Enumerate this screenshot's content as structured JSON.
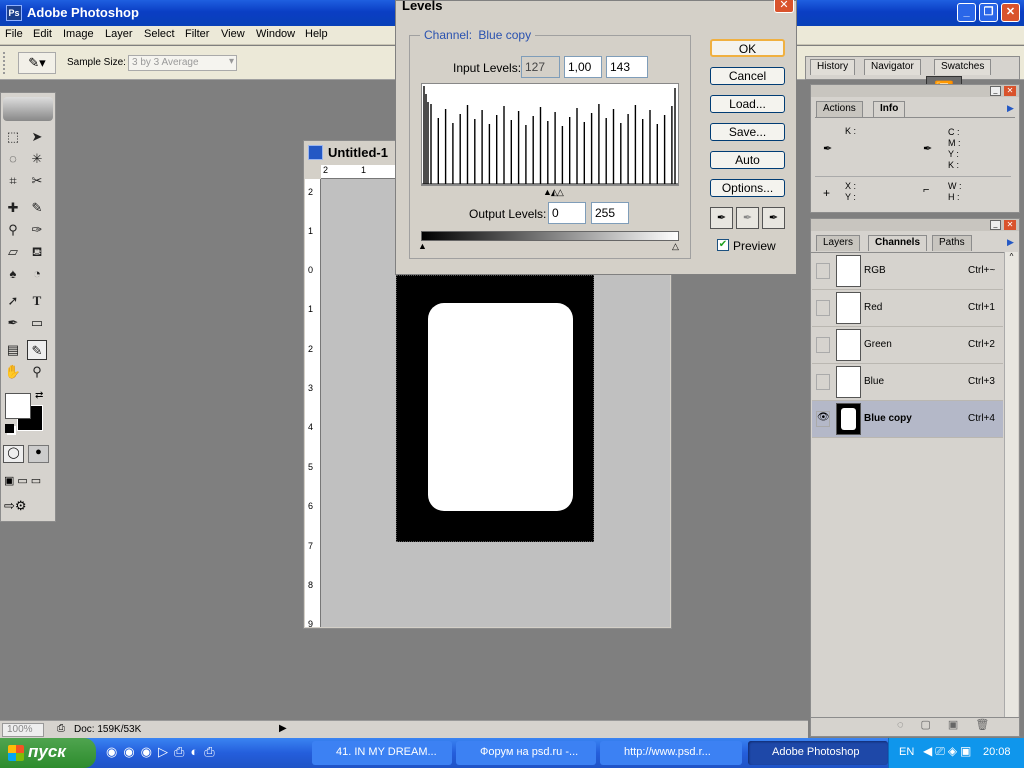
{
  "app": {
    "title": "Adobe Photoshop"
  },
  "menu": [
    "File",
    "Edit",
    "Image",
    "Layer",
    "Select",
    "Filter",
    "View",
    "Window",
    "Help"
  ],
  "options_bar": {
    "sample_size_label": "Sample Size:",
    "sample_size_value": "3 by 3 Average"
  },
  "document": {
    "title": "Untitled-1",
    "ruler_top": [
      "2",
      "1"
    ],
    "ruler_left": [
      "2",
      "1",
      "0",
      "1",
      "2",
      "3",
      "4",
      "5",
      "6",
      "7",
      "8",
      "9"
    ]
  },
  "levels": {
    "title": "Levels",
    "channel_label": "Channel:",
    "channel_value": "Blue copy",
    "input_label": "Input Levels:",
    "input_black": "127",
    "input_gamma": "1,00",
    "input_white": "143",
    "output_label": "Output Levels:",
    "output_black": "0",
    "output_white": "255",
    "buttons": {
      "ok": "OK",
      "cancel": "Cancel",
      "load": "Load...",
      "save": "Save...",
      "auto": "Auto",
      "options": "Options..."
    },
    "preview_label": "Preview",
    "preview_checked": true
  },
  "panel_top": {
    "tabs": [
      "History",
      "Navigator",
      "Swatches"
    ]
  },
  "panel_info": {
    "tabs": [
      "Actions",
      "Info"
    ],
    "k_label": "K :",
    "cmyk_labels": [
      "C :",
      "M :",
      "Y :",
      "K :"
    ],
    "xy_labels": [
      "X :",
      "Y :"
    ],
    "wh_labels": [
      "W :",
      "H :"
    ]
  },
  "panel_channels": {
    "tabs": [
      "Layers",
      "Channels",
      "Paths"
    ],
    "channels": [
      {
        "name": "RGB",
        "shortcut": "Ctrl+~"
      },
      {
        "name": "Red",
        "shortcut": "Ctrl+1"
      },
      {
        "name": "Green",
        "shortcut": "Ctrl+2"
      },
      {
        "name": "Blue",
        "shortcut": "Ctrl+3"
      },
      {
        "name": "Blue copy",
        "shortcut": "Ctrl+4"
      }
    ]
  },
  "status": {
    "zoom": "100%",
    "doc": "Doc: 159K/53K"
  },
  "taskbar": {
    "start_label": "пуск",
    "tasks": [
      "41. IN MY DREAM...",
      "Форум на psd.ru -...",
      "http://www.psd.r...",
      "Adobe Photoshop"
    ],
    "lang": "EN",
    "clock": "20:08"
  }
}
